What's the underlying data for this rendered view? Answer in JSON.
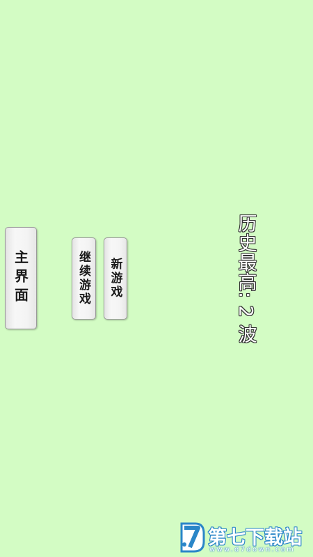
{
  "high_score": {
    "text": "历史最高: 2 波"
  },
  "buttons": {
    "new_game": "新游戏",
    "continue_game": "继续游戏",
    "main_menu": "主界面"
  },
  "watermark": {
    "title": "第七下载站",
    "url": "www.d7down.com"
  },
  "colors": {
    "background": "#d3fcc4",
    "button_face": "#f4f4f4",
    "button_border": "#9a9a9a",
    "button_text": "#1a1a1a",
    "score_text": "#ffffff",
    "score_outline": "#333333",
    "watermark_blue": "#2a86c8"
  },
  "icons": {
    "watermark_logo": "d7-logo-icon"
  }
}
